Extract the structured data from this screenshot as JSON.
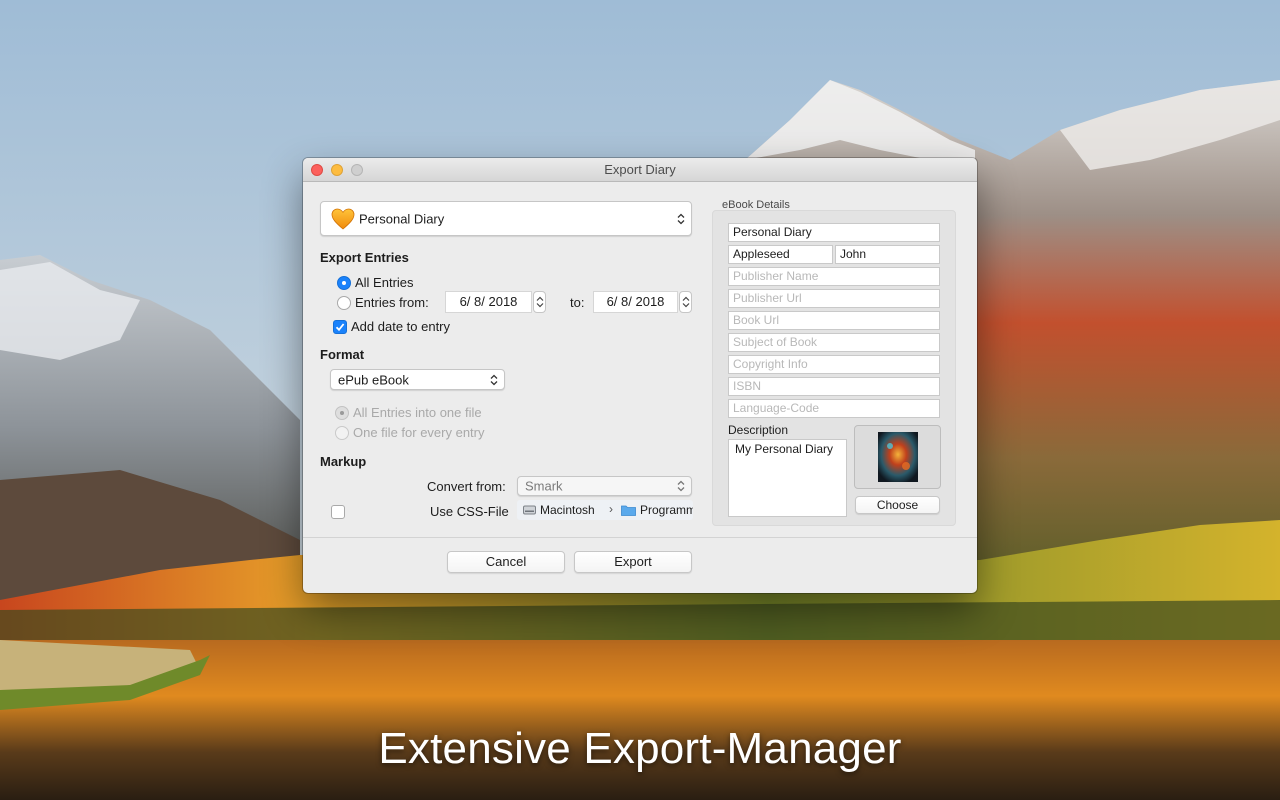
{
  "window": {
    "title": "Export Diary"
  },
  "diary_select": {
    "value": "Personal Diary"
  },
  "export_entries": {
    "title": "Export Entries",
    "all_entries": "All Entries",
    "entries_from": "Entries from:",
    "from_date": "6/ 8/ 2018",
    "to_label": "to:",
    "to_date": "6/ 8/ 2018",
    "add_date": "Add date to entry"
  },
  "format": {
    "title": "Format",
    "value": "ePub eBook",
    "all_into_one": "All Entries into one file",
    "one_per_entry": "One file for every entry"
  },
  "markup": {
    "title": "Markup",
    "convert_from_label": "Convert from:",
    "convert_from_value": "Smark",
    "use_css_label": "Use CSS-File",
    "path": [
      "Macintosh",
      "Programme"
    ]
  },
  "ebook": {
    "title": "eBook Details",
    "book_title": "Personal Diary",
    "author_last": "Appleseed",
    "author_first": "John",
    "publisher_name_ph": "Publisher Name",
    "publisher_url_ph": "Publisher Url",
    "book_url_ph": "Book Url",
    "subject_ph": "Subject of Book",
    "copyright_ph": "Copyright Info",
    "isbn_ph": "ISBN",
    "language_ph": "Language-Code",
    "description_label": "Description",
    "description_value": "My Personal Diary",
    "choose_button": "Choose"
  },
  "buttons": {
    "cancel": "Cancel",
    "export": "Export"
  },
  "caption": "Extensive Export-Manager",
  "colors": {
    "accent": "#1a82fb",
    "close": "#fc605c",
    "minimize": "#fdbc40"
  },
  "icons": {
    "diary": "heart-icon",
    "drive": "hard-drive-icon",
    "folder": "folder-icon"
  }
}
